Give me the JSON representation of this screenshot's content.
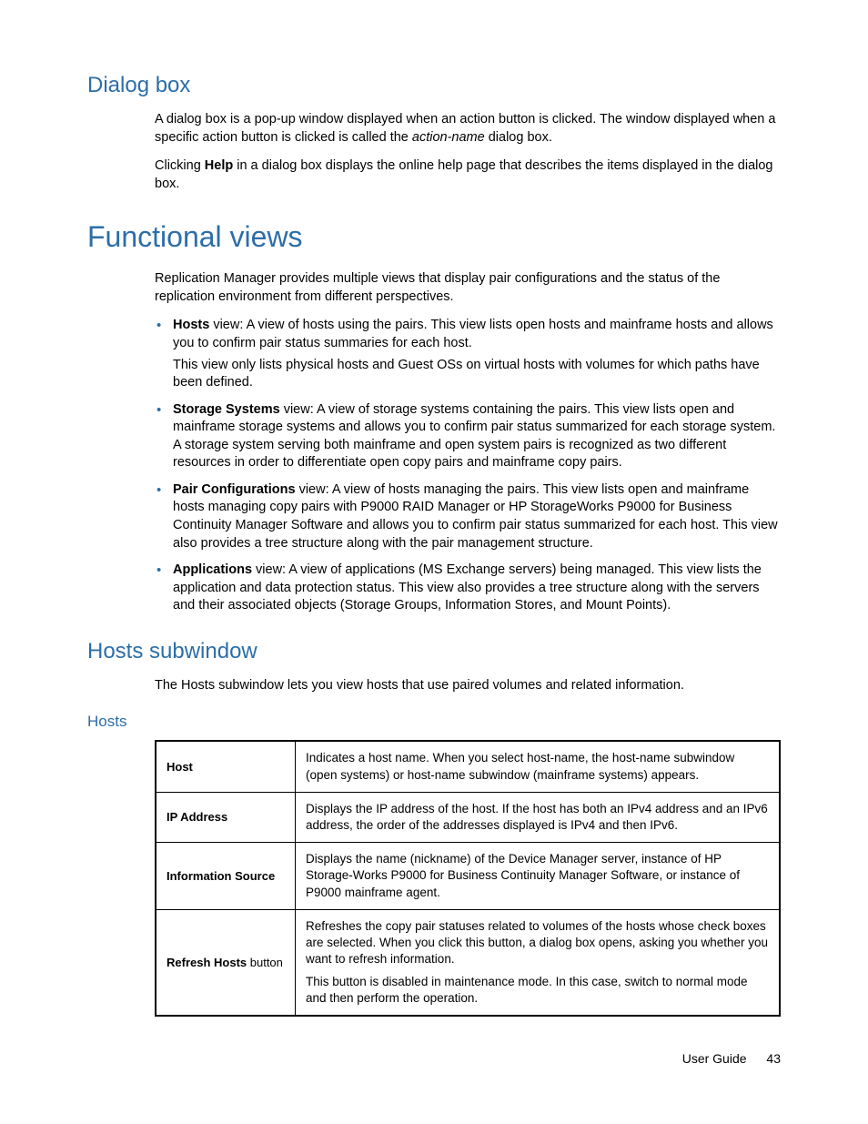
{
  "sections": {
    "dialog_box": {
      "heading": "Dialog box",
      "p1_a": "A dialog box is a pop-up window displayed when an action button is clicked. The window displayed when a specific action button is clicked is called the ",
      "p1_i": "action-name",
      "p1_b": " dialog box.",
      "p2_a": "Clicking ",
      "p2_bold": "Help",
      "p2_b": " in a dialog box displays the online help page that describes the items displayed in the dialog box."
    },
    "functional_views": {
      "heading": "Functional views",
      "intro": "Replication Manager provides multiple views that display pair configurations and the status of the replication environment from different perspectives.",
      "items": [
        {
          "bold": "Hosts",
          "text": " view: A view of hosts using the pairs. This view lists open hosts and mainframe hosts and allows you to confirm pair status summaries for each host.",
          "sub": "This view only lists physical hosts and Guest OSs on virtual hosts with volumes for which paths have been defined."
        },
        {
          "bold": "Storage Systems",
          "text": " view: A view of storage systems containing the pairs. This view lists open and mainframe storage systems and allows you to confirm pair status summarized for each storage system. A storage system serving both mainframe and open system pairs is recognized as two different resources in order to differentiate open copy pairs and mainframe copy pairs."
        },
        {
          "bold": "Pair Configurations",
          "text": " view: A view of hosts managing the pairs. This view lists open and mainframe hosts managing copy pairs with P9000 RAID Manager or HP StorageWorks P9000 for Business Continuity Manager Software and allows you to confirm pair status summarized for each host. This view also provides a tree structure along with the pair management structure."
        },
        {
          "bold": "Applications",
          "text": " view: A view of applications (MS Exchange servers) being managed. This view lists the application and data protection status. This view also provides a tree structure along with the servers and their associated objects (Storage Groups, Information Stores, and Mount Points)."
        }
      ]
    },
    "hosts_subwindow": {
      "heading": "Hosts subwindow",
      "intro": "The Hosts subwindow lets you view hosts that use paired volumes and related information."
    },
    "hosts_table": {
      "heading": "Hosts",
      "rows": [
        {
          "label_bold": "Host",
          "label_rest": "",
          "desc": "Indicates a host name. When you select host-name, the host-name subwindow (open systems) or host-name subwindow (mainframe systems) appears."
        },
        {
          "label_bold": "IP Address",
          "label_rest": "",
          "desc": "Displays the IP address of the host. If the host has both an IPv4 address and an IPv6 address, the order of the addresses displayed is IPv4 and then IPv6."
        },
        {
          "label_bold": "Information Source",
          "label_rest": "",
          "desc": "Displays the name (nickname) of the Device Manager server, instance of HP Storage-Works P9000 for Business Continuity Manager Software, or instance of P9000 mainframe agent."
        },
        {
          "label_bold": "Refresh Hosts",
          "label_rest": " button",
          "desc": "Refreshes the copy pair statuses related to volumes of the hosts whose check boxes are selected. When you click this button, a dialog box opens, asking you whether you want to refresh information.",
          "desc2": "This button is disabled in maintenance mode. In this case, switch to normal mode and then perform the operation."
        }
      ]
    }
  },
  "footer": {
    "label": "User Guide",
    "page": "43"
  }
}
